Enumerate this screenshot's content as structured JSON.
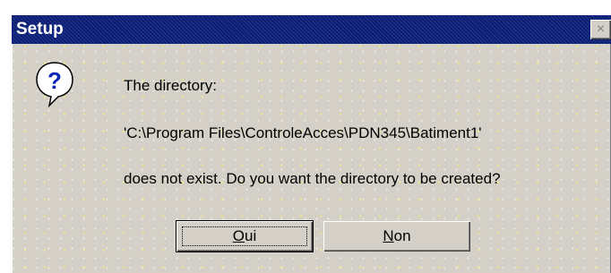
{
  "window": {
    "title": "Setup",
    "close_symbol": "×"
  },
  "icon": {
    "name": "question-icon",
    "glyph": "?"
  },
  "message": {
    "line1": "The directory:",
    "line2": "'C:\\Program Files\\ControleAcces\\PDN345\\Batiment1'",
    "line3": "does not exist.  Do you want the directory to be created?"
  },
  "buttons": {
    "yes": {
      "mnemonic": "O",
      "rest": "ui"
    },
    "no": {
      "mnemonic": "N",
      "rest": "on"
    }
  },
  "colors": {
    "titlebar": "#0a1f7a",
    "dialog_face": "#d4d0c8",
    "icon_fill": "#ffffff",
    "icon_mark": "#0a24b6"
  }
}
